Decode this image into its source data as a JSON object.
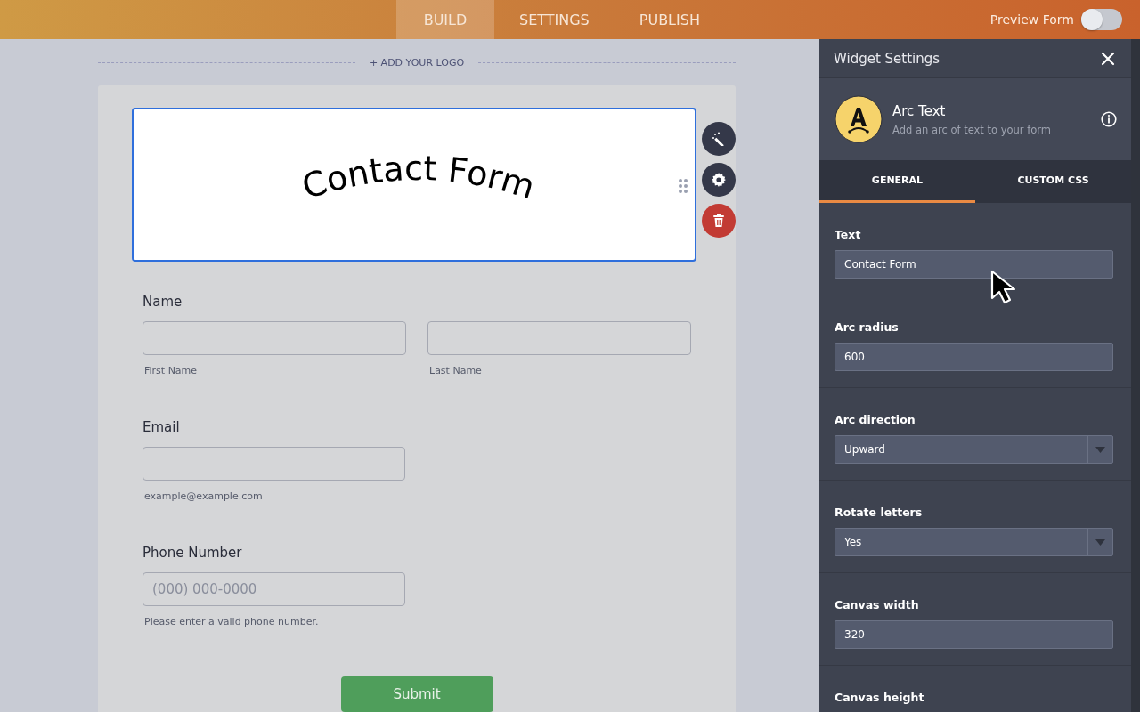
{
  "top_nav": {
    "tabs": [
      {
        "label": "BUILD",
        "selected": true
      },
      {
        "label": "SETTINGS",
        "selected": false
      },
      {
        "label": "PUBLISH",
        "selected": false
      }
    ],
    "preview": {
      "label": "Preview Form",
      "on": false
    }
  },
  "canvas": {
    "logo_link": "+ ADD YOUR LOGO",
    "arc_widget": {
      "text": "Contact Form",
      "selected": true
    },
    "fields": [
      {
        "kind": "pair",
        "label": "Name",
        "inputs": [
          {
            "sublabel": "First Name"
          },
          {
            "sublabel": "Last Name"
          }
        ]
      },
      {
        "kind": "single",
        "label": "Email",
        "inputs": [
          {
            "sublabel": "example@example.com"
          }
        ]
      },
      {
        "kind": "single",
        "label": "Phone Number",
        "inputs": [
          {
            "placeholder": "(000) 000-0000",
            "sublabel": "Please enter a valid phone number."
          }
        ]
      }
    ],
    "submit": "Submit"
  },
  "panel": {
    "title": "Widget Settings",
    "widget": {
      "name": "Arc Text",
      "description": "Add an arc of text to your form"
    },
    "tabs": [
      {
        "label": "GENERAL",
        "selected": true
      },
      {
        "label": "CUSTOM CSS",
        "selected": false
      }
    ],
    "settings": [
      {
        "kind": "text",
        "label": "Text",
        "value": "Contact Form"
      },
      {
        "kind": "text",
        "label": "Arc radius",
        "value": "600"
      },
      {
        "kind": "select",
        "label": "Arc direction",
        "value": "Upward"
      },
      {
        "kind": "select",
        "label": "Rotate letters",
        "value": "Yes"
      },
      {
        "kind": "text",
        "label": "Canvas width",
        "value": "320"
      },
      {
        "kind": "label",
        "label": "Canvas height"
      }
    ]
  }
}
